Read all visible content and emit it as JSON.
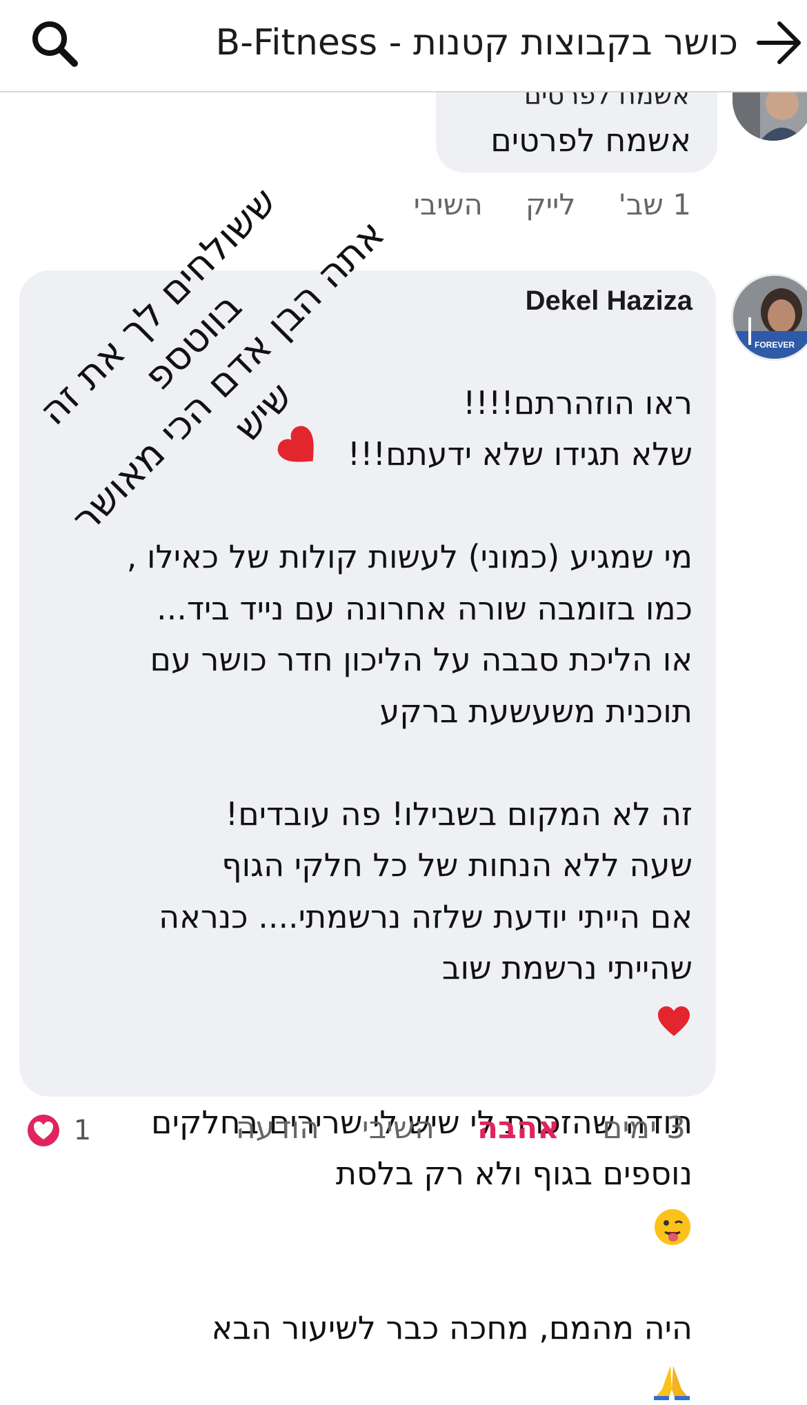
{
  "header": {
    "title": "כושר בקבוצות קטנות - B-Fitness",
    "back_icon": "arrow-right-icon",
    "search_icon": "search-icon"
  },
  "comment1": {
    "cut_line": "אשמח לפרטים",
    "text": "אשמח לפרטים",
    "time": "1 שב'",
    "like": "לייק",
    "reply": "השיבי"
  },
  "comment2": {
    "author": "Dekel Haziza",
    "avatar_badge": "FOREVER",
    "body": "ראו הוזהרתם!!!!\nשלא תגידו שלא ידעתם!!!\n\nמי שמגיע (כמוני) לעשות קולות של כאילו ,\nכמו בזומבה שורה אחרונה עם נייד ביד...\nאו הליכת סבבה על הליכון חדר כושר עם\nתוכנית משעשעת ברקע\n\nזה לא המקום בשבילו! פה עובדים!\nשעה ללא הנחות של כל חלקי הגוף\nאם הייתי יודעת שלזה נרשמתי.... כנראה\nשהייתי נרשמת שוב",
    "body2": "תודה שהזכרת לי שיש לי שרירים בחלקים\nנוספים בגוף ולא רק בלסת",
    "body3": "היה מהמם, מחכה כבר לשיעור הבא",
    "time": "3 ימים",
    "love": "אהבה",
    "reply": "השיבי",
    "message": "הודעה",
    "reaction_count": "1"
  },
  "overlay": {
    "text": "ששולחים לך את זה בווטספ\nאתה הבן אדם הכי מאושר\nשיש"
  },
  "colors": {
    "bubble": "#eef0f4",
    "love": "#e0245e",
    "heart": "#e3262e"
  }
}
